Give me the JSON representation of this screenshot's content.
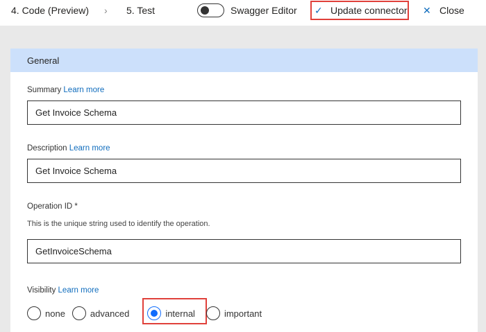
{
  "topbar": {
    "step4": "4. Code (Preview)",
    "chevron": "›",
    "step5": "5. Test",
    "swagger_label": "Swagger Editor",
    "swagger_on": false,
    "update": "Update connector",
    "close": "Close",
    "check_icon": "✓",
    "close_icon": "✕"
  },
  "general": {
    "title": "General",
    "summary": {
      "label": "Summary",
      "learn": "Learn more",
      "value": "Get Invoice Schema"
    },
    "description": {
      "label": "Description",
      "learn": "Learn more",
      "value": "Get Invoice Schema"
    },
    "operation": {
      "label": "Operation ID *",
      "help": "This is the unique string used to identify the operation.",
      "value": "GetInvoiceSchema"
    },
    "visibility": {
      "label": "Visibility",
      "learn": "Learn more",
      "options": [
        "none",
        "advanced",
        "internal",
        "important"
      ],
      "selected": "internal"
    }
  },
  "colors": {
    "accent": "#0f6cfd",
    "highlight": "#e0403a",
    "header": "#cce0fb"
  }
}
